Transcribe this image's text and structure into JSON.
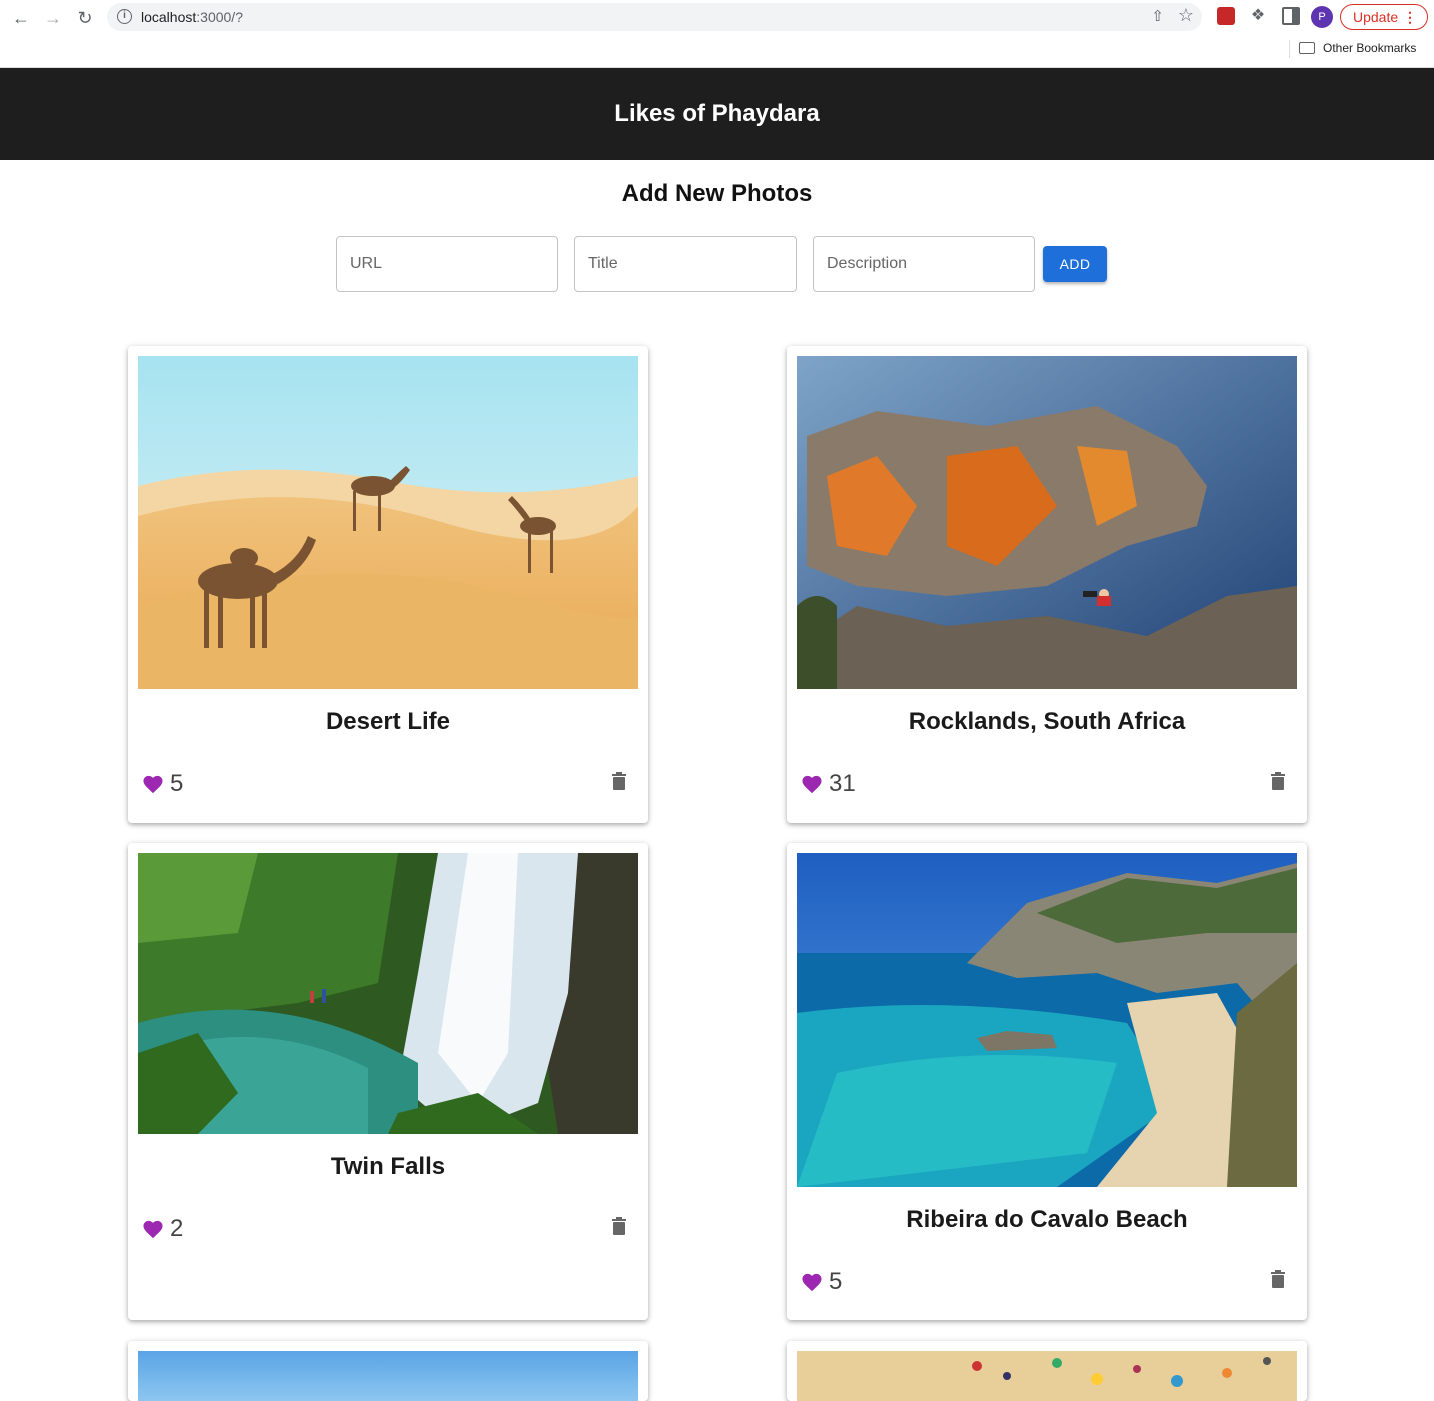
{
  "browser": {
    "url_host": "localhost",
    "url_rest": ":3000/?",
    "avatar_letter": "P",
    "update_label": "Update",
    "bookmarks_label": "Other Bookmarks"
  },
  "header": {
    "title": "Likes of Phaydara"
  },
  "add_form": {
    "heading": "Add New Photos",
    "url_placeholder": "URL",
    "title_placeholder": "Title",
    "description_placeholder": "Description",
    "add_label": "ADD"
  },
  "photos": [
    {
      "title": "Desert Life",
      "likes": "5",
      "image": "desert-camels"
    },
    {
      "title": "Rocklands, South Africa",
      "likes": "31",
      "image": "rock-climbing"
    },
    {
      "title": "Twin Falls",
      "likes": "2",
      "image": "waterfall"
    },
    {
      "title": "Ribeira do Cavalo Beach",
      "likes": "5",
      "image": "beach-cove"
    }
  ],
  "colors": {
    "heart": "#9c27b0",
    "header_bg": "#1e1e1e",
    "add_button": "#1e6fd9"
  }
}
